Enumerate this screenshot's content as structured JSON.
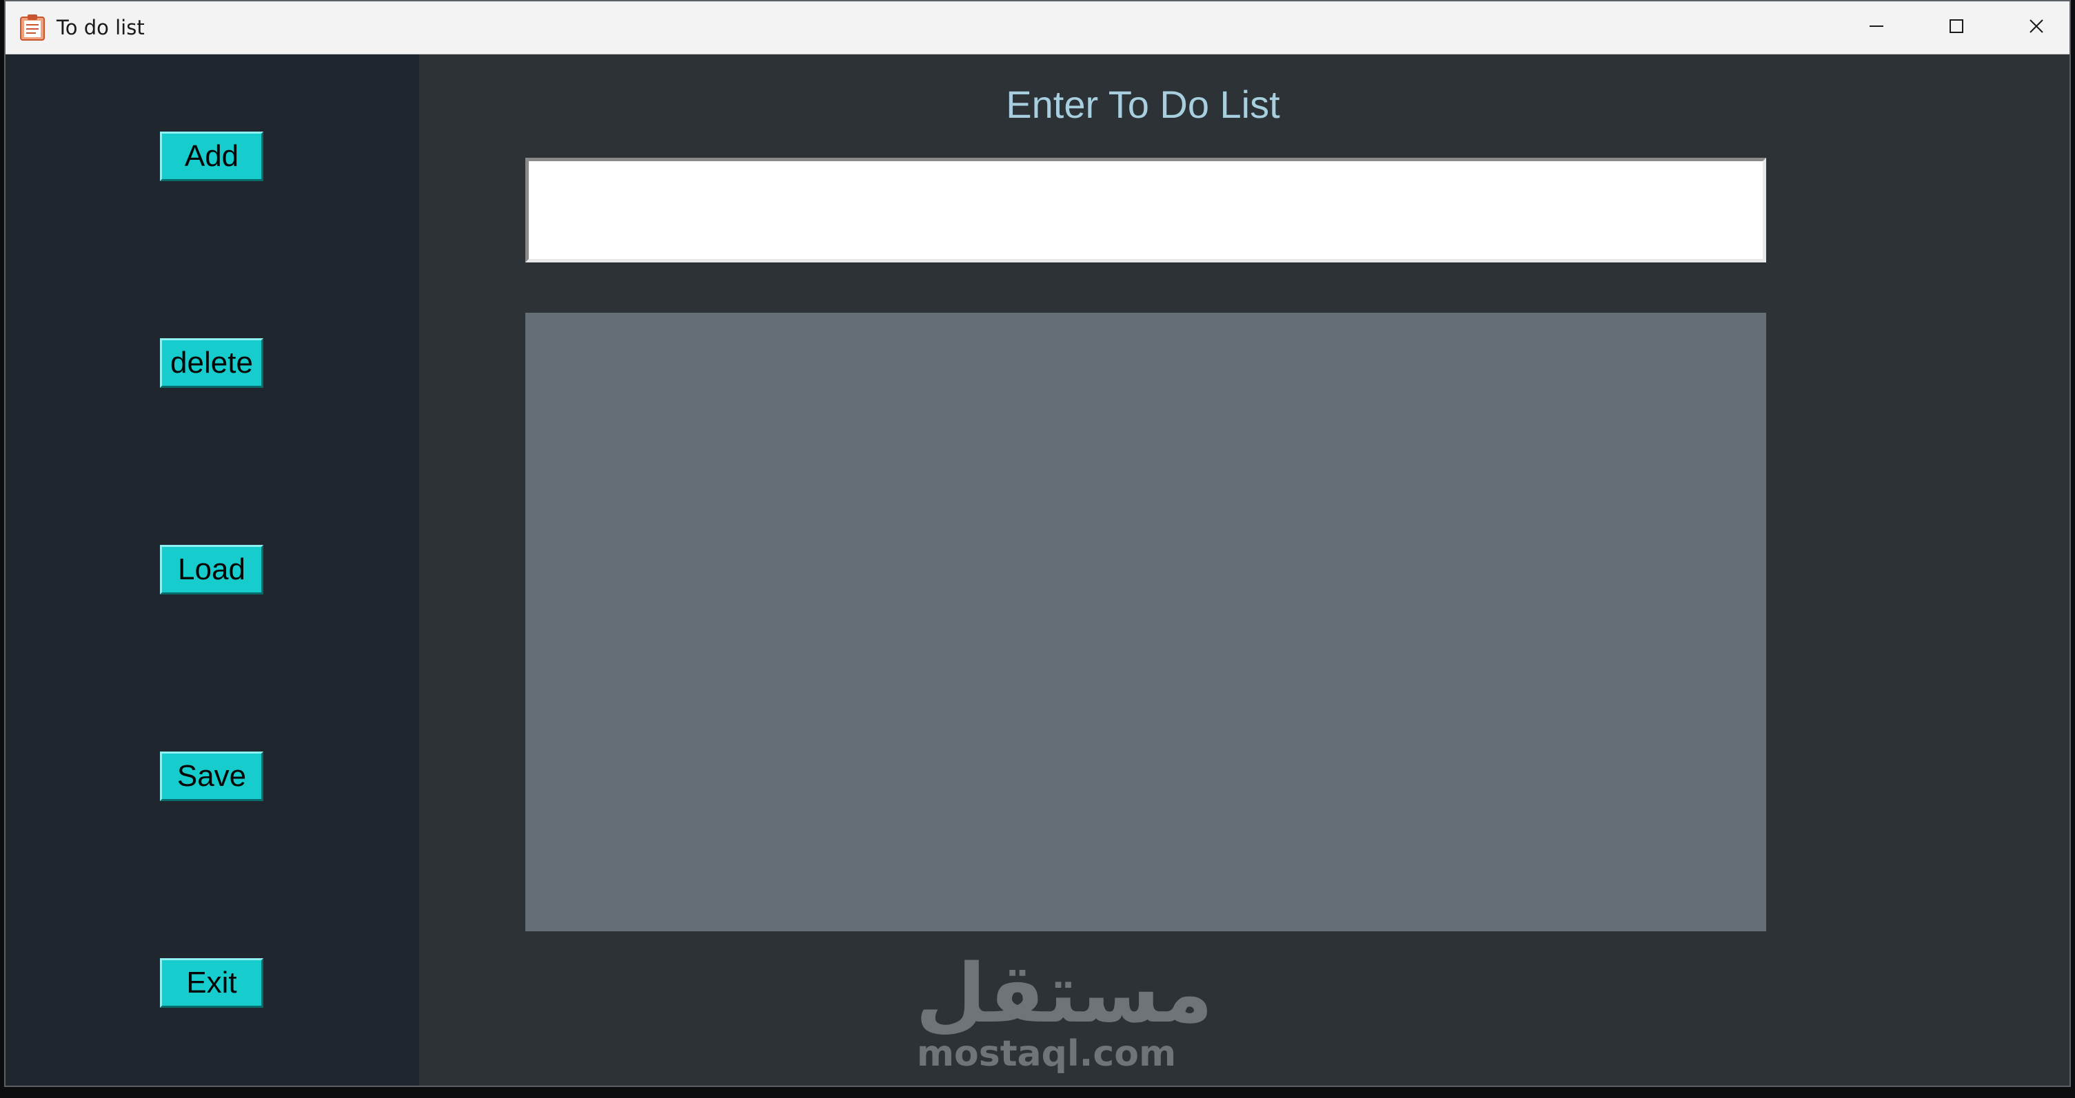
{
  "window": {
    "title": "To do list",
    "icon": "clipboard-icon",
    "controls": {
      "minimize_icon": "minimize-icon",
      "maximize_icon": "maximize-icon",
      "close_icon": "close-icon"
    }
  },
  "sidebar": {
    "buttons": [
      {
        "label": "Add"
      },
      {
        "label": "delete"
      },
      {
        "label": "Load"
      },
      {
        "label": "Save"
      },
      {
        "label": "Exit"
      }
    ]
  },
  "main": {
    "heading": "Enter To Do List",
    "entry": {
      "value": "",
      "placeholder": ""
    },
    "list": {
      "items": []
    }
  },
  "watermark": {
    "arabic": "مستقل",
    "latin": "mostaql.com"
  },
  "colors": {
    "sidebar_bg": "#20262d",
    "main_bg": "#2c3236",
    "button_bg": "#17cccc",
    "heading_text": "#a8cfe0",
    "list_bg": "#646e75"
  }
}
